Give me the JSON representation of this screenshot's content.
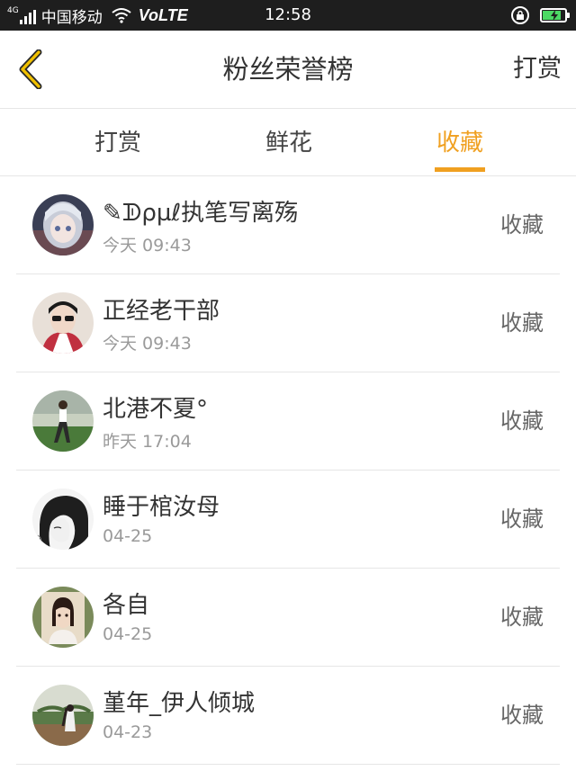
{
  "status_bar": {
    "network_type": "4G",
    "carrier": "中国移动",
    "volte": "VoLTE",
    "time": "12:58",
    "battery_percent": 85
  },
  "header": {
    "title": "粉丝荣誉榜",
    "action_label": "打赏",
    "back_icon": "chevron-left-icon",
    "accent_color": "#f0a020"
  },
  "tabs": [
    {
      "label": "打赏",
      "active": false
    },
    {
      "label": "鲜花",
      "active": false
    },
    {
      "label": "收藏",
      "active": true
    }
  ],
  "list": {
    "items": [
      {
        "name": "✎ᗫρµℓ执笔写离殇",
        "time": "今天 09:43",
        "action": "收藏"
      },
      {
        "name": "正经老干部",
        "time": "今天 09:43",
        "action": "收藏"
      },
      {
        "name": "北港不夏°",
        "time": "昨天 17:04",
        "action": "收藏"
      },
      {
        "name": "睡于棺汝母",
        "time": "04-25",
        "action": "收藏"
      },
      {
        "name": "各自",
        "time": "04-25",
        "action": "收藏"
      },
      {
        "name": "堇年_伊人倾城",
        "time": "04-23",
        "action": "收藏"
      }
    ]
  }
}
